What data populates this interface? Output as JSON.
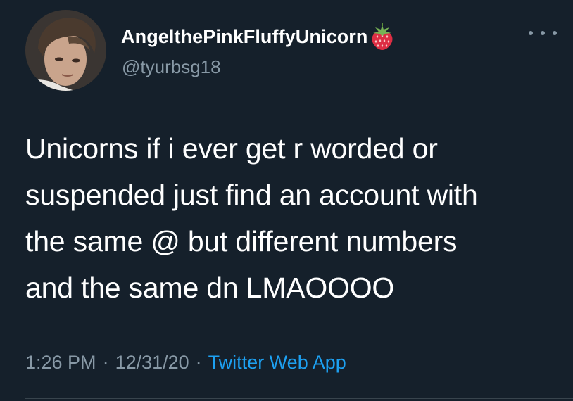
{
  "tweet": {
    "author": {
      "display_name": "AngelthePinkFluffyUnicorn",
      "handle": "@tyurbsg18",
      "name_emoji_icon": "strawberry-icon"
    },
    "text_lines": [
      "Unicorns if i ever get r worded or",
      "suspended just find an account with",
      "the same @ but different numbers",
      "and the same dn LMAOOOO"
    ],
    "meta": {
      "time": "1:26 PM",
      "date": "12/31/20",
      "source": "Twitter Web App",
      "separator": "·"
    },
    "more_icon": "more-horizontal-icon"
  },
  "colors": {
    "background": "#15202b",
    "text_primary": "#ffffff",
    "text_secondary": "#8899a6",
    "link": "#1da1f2",
    "divider": "#38444d"
  }
}
